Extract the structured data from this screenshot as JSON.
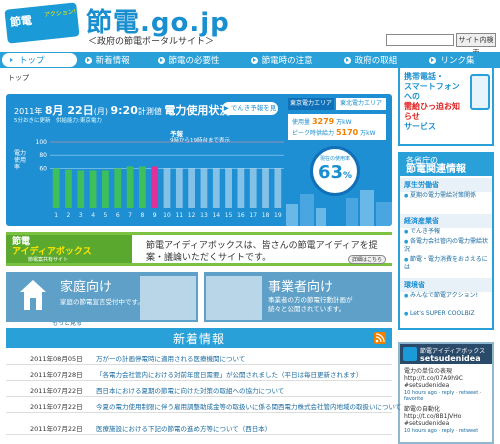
{
  "header": {
    "logo_text": "節電",
    "logo_sub": "アクション!",
    "title": "節電.go.jp",
    "subtitle": "＜政府の節電ポータルサイト＞",
    "search_button": "サイト内検索"
  },
  "nav": [
    {
      "label": "トップ"
    },
    {
      "label": "新着情報"
    },
    {
      "label": "節電の必要性"
    },
    {
      "label": "節電時の注意"
    },
    {
      "label": "政府の取組"
    },
    {
      "label": "リンク集"
    }
  ],
  "breadcrumb": "トップ",
  "usage": {
    "year": "2011年",
    "date": "8月 22日",
    "dow": "(月)",
    "time": "9:20",
    "time_suffix": "計測値",
    "heading": "電力使用状況",
    "note": "5分おきに更新　供給能力:東京電力",
    "forecast_button": "▶ でんき予報を見る",
    "tab_tokyo": "東京電力エリア",
    "tab_tohoku": "東北電力エリア",
    "current_label": "使用量",
    "current_value": "3279",
    "current_unit": "万kW",
    "peak_label": "ピーク時供給力",
    "peak_value": "5170",
    "peak_unit": "万kW",
    "forecast_label": "予報",
    "forecast_range": "9時から19時台まで表示",
    "ylabel": "電力使用率",
    "rate_label": "現在の使用率",
    "rate_value": "63",
    "rate_unit": "%"
  },
  "chart_data": {
    "type": "bar",
    "categories": [
      "1",
      "2",
      "3",
      "4",
      "5",
      "6",
      "7",
      "8",
      "9",
      "10",
      "11",
      "12",
      "13",
      "14",
      "15",
      "16",
      "17",
      "18",
      "19"
    ],
    "values": [
      60,
      58,
      57,
      57,
      57,
      60,
      63,
      63,
      63,
      60,
      60,
      60,
      60,
      60,
      60,
      60,
      60,
      60,
      60
    ],
    "ylim": [
      0,
      100
    ],
    "yticks": [
      60,
      80,
      100
    ],
    "current_hour": "9",
    "colors": {
      "actual": "#3dbf5c",
      "current": "#e0309a",
      "forecast": "#ffffff"
    }
  },
  "mobile": {
    "line1": "携帯電話・",
    "line2": "スマートフォンへの",
    "line3": "需給ひっ迫お知らせ",
    "line4": "サービス"
  },
  "sidebar": {
    "head1": "各省庁の",
    "head2": "節電関連情報",
    "sections": [
      {
        "title": "厚生労働省",
        "items": [
          "夏期の電力需給対策関係"
        ]
      },
      {
        "title": "経済産業省",
        "items": [
          "でんき予報",
          "各電力会社管内の電力需給状況",
          "節電・電力消費をおさえるには"
        ]
      },
      {
        "title": "環境省",
        "items": [
          "みんなで節電アクション!",
          "Let's SUPER COOLBIZ"
        ]
      }
    ],
    "more": "もっと見る"
  },
  "twitter": {
    "title": "節電アイディアボックス",
    "user": "setsudenidea",
    "tweet1": "電力の単位の表現 http://t.co/07A9h9C #setsudenidea",
    "meta1": "10 hours ago · reply · retweet · favorite",
    "tweet2": "節電の自動化 http://t.co/8B1JVHo #setsudenidea",
    "meta2": "10 hours ago · reply · retweet"
  },
  "idea": {
    "logo1": "節電",
    "logo2": "アイディアボックス",
    "logo_sub": "節電案共有サイト",
    "text": "節電アイディアボックスは、皆さんの節電アイディアを提案・議論いただくサイトです。",
    "button": "詳細はこちら"
  },
  "home": {
    "title": "家庭向け",
    "desc": "家庭の節電宣言受付中です。"
  },
  "biz": {
    "title": "事業者向け",
    "desc1": "事業者の方の節電行動計画が",
    "desc2": "続々と公開されています。"
  },
  "news": {
    "title": "新着情報",
    "items": [
      {
        "date": "2011年08月05日",
        "text": "万が一の計画停電時に適用される医療機関について"
      },
      {
        "date": "2011年07月28日",
        "text": "「各電力会社管内における対前年度日需要」が公開されました（平日は毎日更新されます）"
      },
      {
        "date": "2011年07月22日",
        "text": "西日本における夏期の節電に向けた対策の取組への協力について"
      },
      {
        "date": "2011年07月22日",
        "text": "今夏の電力使用制限に伴う雇用調整助成金等の取扱いに係る関西電力株式会社管内地域の取扱いについて"
      },
      {
        "date": "2011年07月22日",
        "text": "医療施設における下記の節電の進め方等について（西日本）"
      }
    ]
  }
}
